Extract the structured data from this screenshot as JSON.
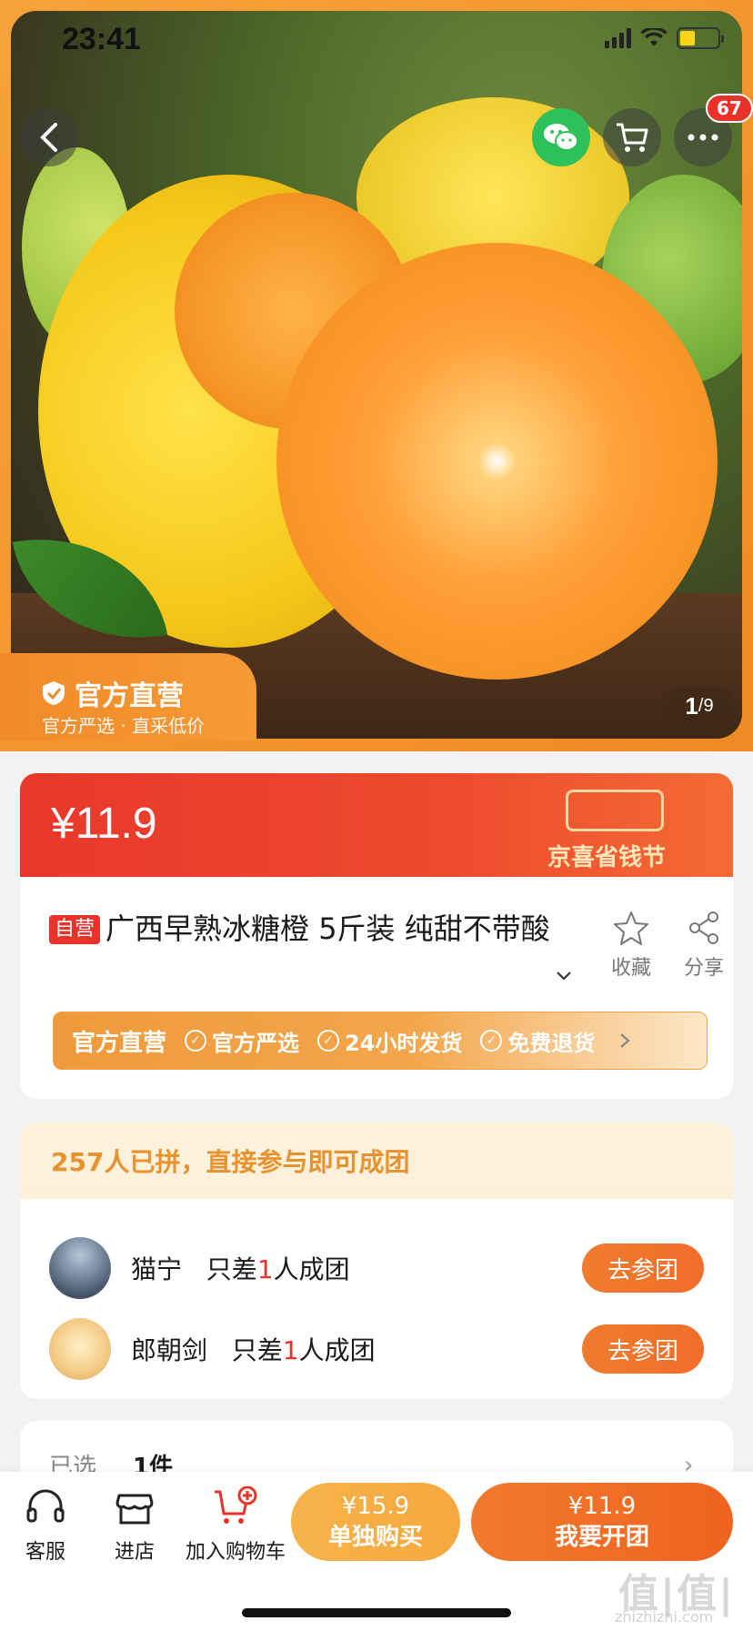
{
  "status": {
    "time": "23:41"
  },
  "hero": {
    "cart_badge": "67",
    "official_title": "官方直营",
    "official_sub": "官方严选 · 直采低价",
    "page_current": "1",
    "page_total": "/9"
  },
  "price": {
    "value": "¥11.9",
    "festival": "京喜省钱节"
  },
  "product": {
    "self_tag": "自营",
    "title": "广西早熟冰糖橙 5斤装 纯甜不带酸",
    "fav_label": "收藏",
    "share_label": "分享"
  },
  "promo": {
    "lead": "官方直营",
    "items": [
      "官方严选",
      "24小时发货",
      "免费退货"
    ]
  },
  "group": {
    "header": "257人已拼，直接参与即可成团",
    "rows": [
      {
        "name": "猫宁",
        "pre": "只差",
        "count": "1",
        "post": "人成团",
        "button": "去参团"
      },
      {
        "name": "郎朝剑",
        "pre": "只差",
        "count": "1",
        "post": "人成团",
        "button": "去参团"
      }
    ]
  },
  "selected": {
    "label": "已选",
    "value": "1件"
  },
  "bottom": {
    "service": "客服",
    "store": "进店",
    "add_cart": "加入购物车",
    "single_price": "¥15.9",
    "single_label": "单独购买",
    "group_price": "¥11.9",
    "group_label": "我要开团"
  },
  "watermark": {
    "main": "值|值|值",
    "sub": "zhizhizhi.com"
  },
  "colors": {
    "accent": "#ee6320",
    "red": "#e8322a",
    "wechat": "#2ec15b"
  }
}
